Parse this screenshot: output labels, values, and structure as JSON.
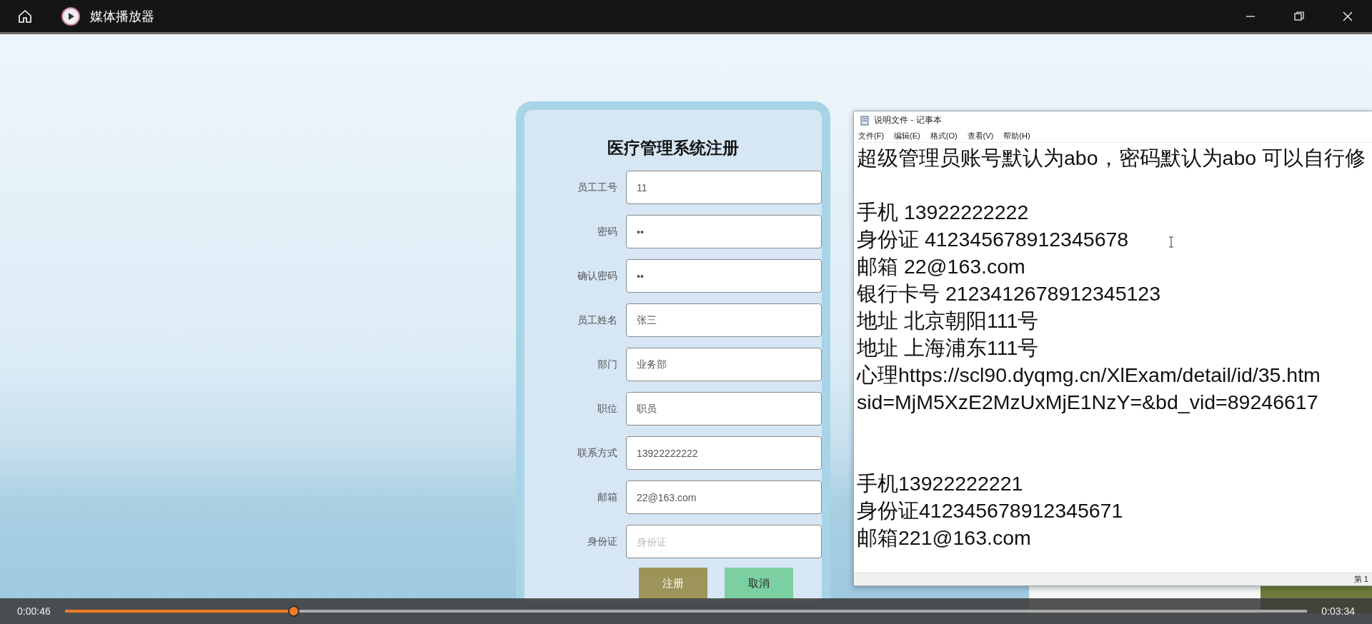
{
  "player": {
    "title": "媒体播放器"
  },
  "form": {
    "title": "医疗管理系统注册",
    "fields": [
      {
        "label": "员工工号",
        "value": "11"
      },
      {
        "label": "密码",
        "value": "••"
      },
      {
        "label": "确认密码",
        "value": "••"
      },
      {
        "label": "员工姓名",
        "value": "张三"
      },
      {
        "label": "部门",
        "value": "业务部"
      },
      {
        "label": "职位",
        "value": "职员"
      },
      {
        "label": "联系方式",
        "value": "13922222222"
      },
      {
        "label": "邮箱",
        "value": "22@163.com"
      },
      {
        "label": "身份证",
        "placeholder": "身份证"
      }
    ],
    "buttons": [
      {
        "label": "注册",
        "kind": "primary"
      },
      {
        "label": "取消",
        "kind": "secondary"
      }
    ]
  },
  "notepad": {
    "title": "说明文件 - 记事本",
    "menu": [
      "文件(F)",
      "编辑(E)",
      "格式(O)",
      "查看(V)",
      "帮助(H)"
    ],
    "blocks": [
      [
        "超级管理员账号默认为abo，密码默认为abo 可以自行修"
      ],
      [
        "手机 13922222222",
        "身份证 412345678912345678",
        "邮箱 22@163.com",
        "银行卡号 212341267891234512​3",
        "地址 北京朝阳111号",
        "地址 上海浦东111号",
        "心理https://scl90.dyqmg.cn/XlExam/detail/id/35.htm",
        "sid=MjM5XzE2MzUxMjE1NzY=&bd_vid=89246617"
      ],
      [
        "手机13922222221",
        "身份证412345678912345671",
        "邮箱221@163.com"
      ]
    ],
    "status": "第 1"
  },
  "playback": {
    "elapsed": "0:00:46",
    "total": "0:03:34",
    "level": 0.184
  }
}
